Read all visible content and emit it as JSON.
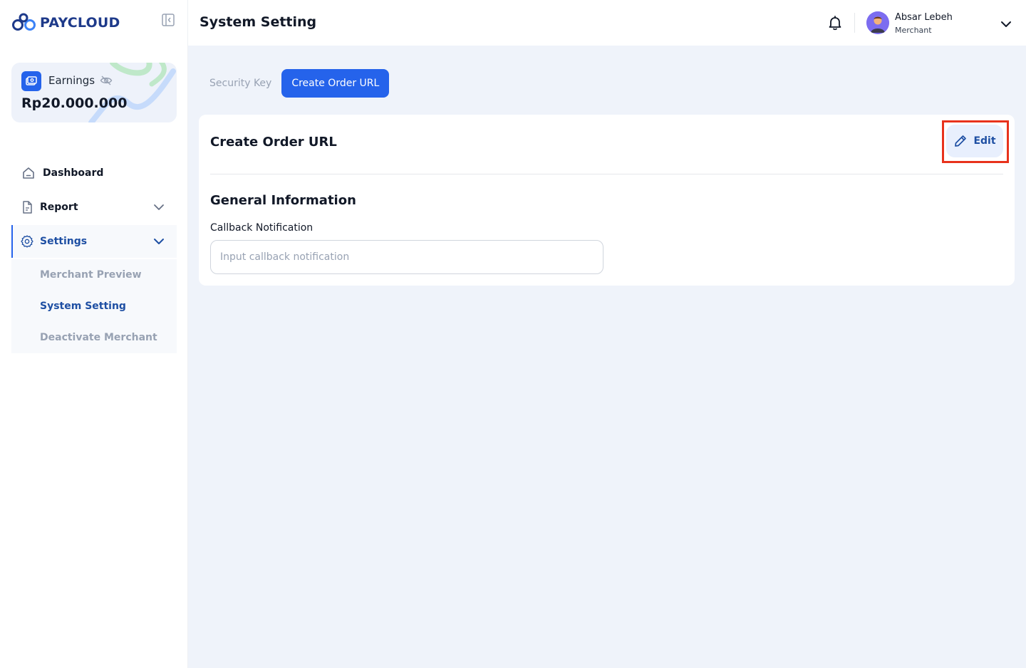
{
  "brand": {
    "name": "PAYCLOUD"
  },
  "earnings": {
    "label": "Earnings",
    "value": "Rp20.000.000"
  },
  "nav": {
    "dashboard": "Dashboard",
    "report": "Report",
    "settings": "Settings",
    "sub_items": [
      "Merchant Preview",
      "System Setting",
      "Deactivate Merchant"
    ]
  },
  "header": {
    "title": "System Setting",
    "user_name": "Absar Lebeh",
    "user_role": "Merchant"
  },
  "tabs": [
    "Security Key",
    "Create Order URL"
  ],
  "card": {
    "title": "Create Order URL",
    "edit_label": "Edit",
    "section_title": "General Information",
    "field_label": "Callback Notification",
    "field_placeholder": "Input callback notification",
    "field_value": ""
  },
  "colors": {
    "primary": "#2563eb",
    "primary_dark": "#1e4fa3",
    "background": "#eff3fa",
    "highlight": "#e8321c"
  }
}
